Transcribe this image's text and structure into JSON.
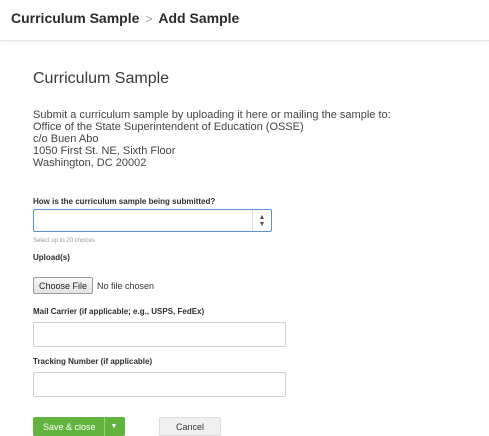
{
  "breadcrumb": {
    "parent": "Curriculum Sample",
    "separator": ">",
    "current": "Add Sample"
  },
  "page": {
    "title": "Curriculum Sample",
    "instructions": [
      "Submit a curriculum sample by uploading it here or mailing the sample to:",
      "Office of the State Superintendent of Education (OSSE)",
      "c/o Buen Abo",
      "1050 First St. NE, Sixth Floor",
      "Washington, DC 20002"
    ]
  },
  "form": {
    "submission_method": {
      "label": "How is the curriculum sample being submitted?",
      "value": "",
      "hint": "Select up to 20 choices"
    },
    "uploads": {
      "label": "Upload(s)",
      "button": "Choose File",
      "status": "No file chosen"
    },
    "mail_carrier": {
      "label": "Mail Carrier (if applicable; e.g., USPS, FedEx)",
      "value": ""
    },
    "tracking_number": {
      "label": "Tracking Number (if applicable)",
      "value": ""
    }
  },
  "actions": {
    "save": "Save & close",
    "cancel": "Cancel"
  },
  "colors": {
    "save_button": "#63b33f",
    "focus_border": "#5b8fd6"
  },
  "icons": {
    "select_arrows": "up-down-chevrons-icon",
    "save_dropdown": "caret-down-icon"
  }
}
